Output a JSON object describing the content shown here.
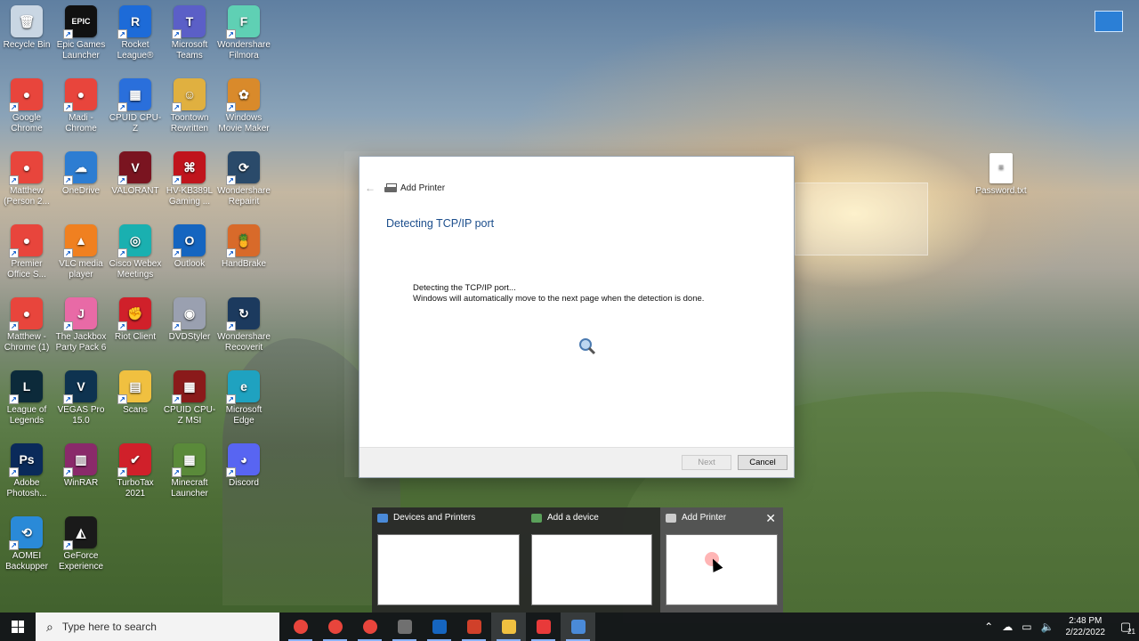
{
  "desktop": {
    "icons": [
      {
        "label": "Recycle Bin",
        "color": "#c9d6e3",
        "glyph": "🗑"
      },
      {
        "label": "Epic Games Launcher",
        "color": "#111111",
        "glyph": "EPIC"
      },
      {
        "label": "Rocket League®",
        "color": "#1d6bd8",
        "glyph": "R"
      },
      {
        "label": "Microsoft Teams",
        "color": "#5b5fc7",
        "glyph": "T"
      },
      {
        "label": "Wondershare Filmora",
        "color": "#5fd0b4",
        "glyph": "F"
      },
      {
        "label": "Google Chrome",
        "color": "#e8453c",
        "glyph": "●"
      },
      {
        "label": "Madi - Chrome",
        "color": "#e8453c",
        "glyph": "●"
      },
      {
        "label": "CPUID CPU-Z",
        "color": "#2a6fdb",
        "glyph": "▦"
      },
      {
        "label": "Toontown Rewritten",
        "color": "#e0b040",
        "glyph": "☺"
      },
      {
        "label": "Windows Movie Maker",
        "color": "#d98a2b",
        "glyph": "✿"
      },
      {
        "label": "Matthew (Person 2...",
        "color": "#e8453c",
        "glyph": "●"
      },
      {
        "label": "OneDrive",
        "color": "#2d7dd2",
        "glyph": "☁"
      },
      {
        "label": "VALORANT",
        "color": "#7a1420",
        "glyph": "V"
      },
      {
        "label": "HV-KB389L Gaming ...",
        "color": "#c0141c",
        "glyph": "⌘"
      },
      {
        "label": "Wondershare Repairit",
        "color": "#2a4a6a",
        "glyph": "⟳"
      },
      {
        "label": "Premier Office S...",
        "color": "#e8453c",
        "glyph": "●"
      },
      {
        "label": "VLC media player",
        "color": "#f08020",
        "glyph": "▲"
      },
      {
        "label": "Cisco Webex Meetings",
        "color": "#1ab0b0",
        "glyph": "◎"
      },
      {
        "label": "Outlook",
        "color": "#1565c0",
        "glyph": "O"
      },
      {
        "label": "HandBrake",
        "color": "#d86a2a",
        "glyph": "🍍"
      },
      {
        "label": "Matthew - Chrome (1)",
        "color": "#e8453c",
        "glyph": "●"
      },
      {
        "label": "The Jackbox Party Pack 6",
        "color": "#e86aa6",
        "glyph": "J"
      },
      {
        "label": "Riot Client",
        "color": "#d0202a",
        "glyph": "✊"
      },
      {
        "label": "DVDStyler",
        "color": "#9aa0b0",
        "glyph": "◉"
      },
      {
        "label": "Wondershare Recoverit",
        "color": "#1c3a5e",
        "glyph": "↻"
      },
      {
        "label": "League of Legends",
        "color": "#0c2a3a",
        "glyph": "L"
      },
      {
        "label": "VEGAS Pro 15.0",
        "color": "#0e3350",
        "glyph": "V"
      },
      {
        "label": "Scans",
        "color": "#f0c040",
        "glyph": "▤"
      },
      {
        "label": "CPUID CPU-Z MSI",
        "color": "#8a1a1a",
        "glyph": "▦"
      },
      {
        "label": "Microsoft Edge",
        "color": "#1fa2c0",
        "glyph": "e"
      },
      {
        "label": "Adobe Photosh...",
        "color": "#0a2a5a",
        "glyph": "Ps"
      },
      {
        "label": "WinRAR",
        "color": "#8a2a6a",
        "glyph": "▥"
      },
      {
        "label": "TurboTax 2021",
        "color": "#d0202a",
        "glyph": "✔"
      },
      {
        "label": "Minecraft Launcher",
        "color": "#5a8a3a",
        "glyph": "▦"
      },
      {
        "label": "Discord",
        "color": "#5865f2",
        "glyph": "◕"
      },
      {
        "label": "AOMEI Backupper",
        "color": "#2a8ad8",
        "glyph": "⟲"
      },
      {
        "label": "GeForce Experience",
        "color": "#1a1a1a",
        "glyph": "◭"
      }
    ],
    "right_icons": [
      {
        "label": "Password.txt"
      }
    ]
  },
  "dialog": {
    "header_title": "Add Printer",
    "back_label": "←",
    "title": "Detecting TCP/IP port",
    "body_line1": "Detecting the TCP/IP port...",
    "body_line2": "Windows will automatically move to the next page when the detection is done.",
    "next_label": "Next",
    "cancel_label": "Cancel"
  },
  "thumbnails": [
    {
      "title": "Devices and Printers",
      "active": false
    },
    {
      "title": "Add a device",
      "active": false
    },
    {
      "title": "Add Printer",
      "active": true,
      "close": "✕"
    }
  ],
  "taskbar": {
    "search_placeholder": "Type here to search",
    "time": "2:48 PM",
    "date": "2/22/2022",
    "notification_count": "21",
    "apps": [
      {
        "name": "chrome-m",
        "color": "#e8453c",
        "open": true
      },
      {
        "name": "chrome-2",
        "color": "#e8453c",
        "open": true
      },
      {
        "name": "chrome-3",
        "color": "#e8453c",
        "open": true
      },
      {
        "name": "calculator",
        "color": "#707070",
        "open": true
      },
      {
        "name": "outlook",
        "color": "#1565c0",
        "open": true
      },
      {
        "name": "snip",
        "color": "#d0402a",
        "open": true
      },
      {
        "name": "file-explorer",
        "color": "#f0c040",
        "open": true,
        "active": true
      },
      {
        "name": "recorder",
        "color": "#e83a3a",
        "open": true
      },
      {
        "name": "control-panel",
        "color": "#4a8ad8",
        "open": true,
        "active": true
      }
    ]
  }
}
